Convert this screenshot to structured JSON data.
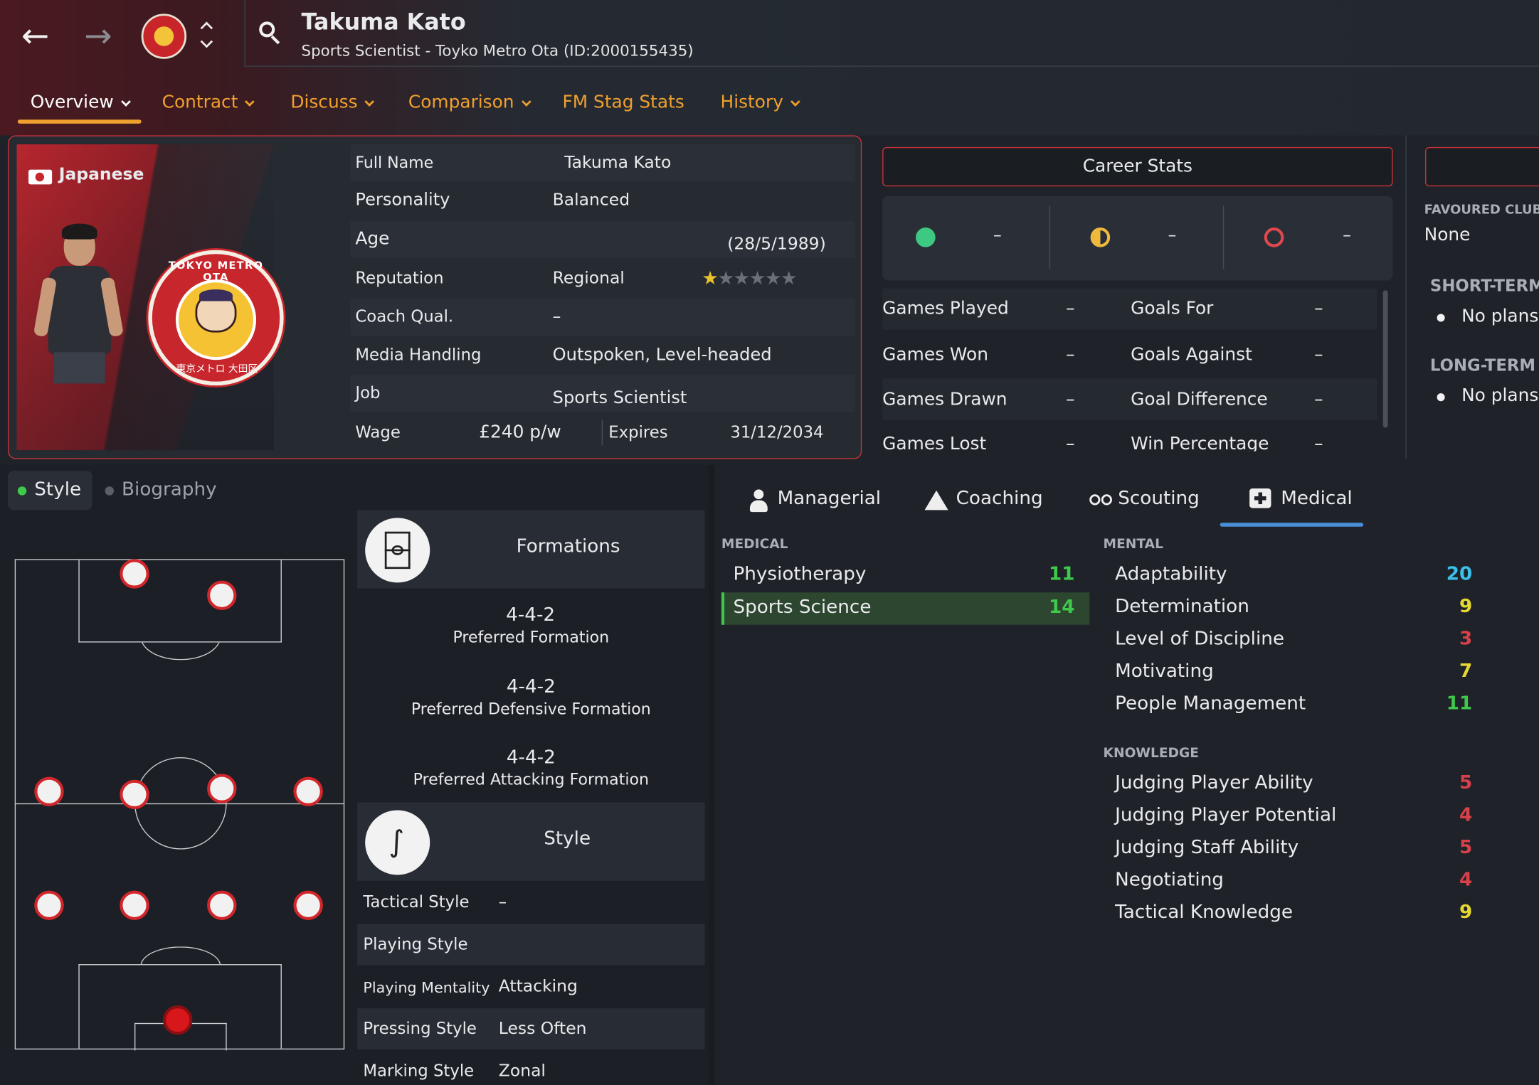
{
  "header": {
    "name": "Takuma Kato",
    "subtitle": "Sports Scientist - Toyko Metro Ota (ID:2000155435)"
  },
  "tabs": [
    {
      "label": "Overview"
    },
    {
      "label": "Contract"
    },
    {
      "label": "Discuss"
    },
    {
      "label": "Comparison"
    },
    {
      "label": "FM Stag Stats"
    },
    {
      "label": "History"
    }
  ],
  "profile": {
    "nationality": "Japanese",
    "club_badge_text": "TOKYO METRO OTA",
    "club_badge_sub": "東京メトロ 大田区",
    "rows": {
      "full_name_label": "Full Name",
      "full_name": "Takuma Kato",
      "personality_label": "Personality",
      "personality": "Balanced",
      "age_label": "Age",
      "age": "(28/5/1989)",
      "reputation_label": "Reputation",
      "reputation": "Regional",
      "reputation_stars": 0.5,
      "coach_label": "Coach Qual.",
      "coach": "–",
      "media_label": "Media Handling",
      "media": "Outspoken, Level-headed",
      "job_label": "Job",
      "job": "Sports Scientist",
      "wage_label": "Wage",
      "wage": "£240 p/w",
      "expires_label": "Expires",
      "expires": "31/12/2034"
    }
  },
  "career": {
    "title": "Career Stats",
    "results": [
      "–",
      "–",
      "–"
    ],
    "left_labels": [
      "Games Played",
      "Games Won",
      "Games Drawn",
      "Games Lost"
    ],
    "left_values": [
      "–",
      "–",
      "–",
      "–"
    ],
    "right_labels": [
      "Goals For",
      "Goals Against",
      "Goal Difference",
      "Win Percentage"
    ],
    "right_values": [
      "–",
      "–",
      "–",
      "–"
    ]
  },
  "right_panel": {
    "favoured_label": "FAVOURED CLUB",
    "favoured": "None",
    "short_label": "SHORT-TERM",
    "short_item": "No plans",
    "long_label": "LONG-TERM",
    "long_item": "No plans"
  },
  "style_tabs": {
    "style": "Style",
    "biography": "Biography"
  },
  "formations": {
    "header": "Formations",
    "items": [
      {
        "value": "4-4-2",
        "label": "Preferred Formation"
      },
      {
        "value": "4-4-2",
        "label": "Preferred Defensive Formation"
      },
      {
        "value": "4-4-2",
        "label": "Preferred Attacking Formation"
      }
    ]
  },
  "style": {
    "header": "Style",
    "rows": [
      {
        "label": "Tactical Style",
        "value": "–"
      },
      {
        "label": "Playing Style",
        "value": ""
      },
      {
        "label": "Playing Mentality",
        "value": "Attacking"
      },
      {
        "label": "Pressing Style",
        "value": "Less Often"
      },
      {
        "label": "Marking Style",
        "value": "Zonal"
      }
    ]
  },
  "attr_tabs": {
    "managerial": "Managerial",
    "coaching": "Coaching",
    "scouting": "Scouting",
    "medical": "Medical"
  },
  "attributes": {
    "medical_label": "MEDICAL",
    "medical": [
      {
        "name": "Physiotherapy",
        "value": "11"
      },
      {
        "name": "Sports Science",
        "value": "14"
      }
    ],
    "mental_label": "MENTAL",
    "mental": [
      {
        "name": "Adaptability",
        "value": "20"
      },
      {
        "name": "Determination",
        "value": "9"
      },
      {
        "name": "Level of Discipline",
        "value": "3"
      },
      {
        "name": "Motivating",
        "value": "7"
      },
      {
        "name": "People Management",
        "value": "11"
      }
    ],
    "knowledge_label": "KNOWLEDGE",
    "knowledge": [
      {
        "name": "Judging Player Ability",
        "value": "5"
      },
      {
        "name": "Judging Player Potential",
        "value": "4"
      },
      {
        "name": "Judging Staff Ability",
        "value": "5"
      },
      {
        "name": "Negotiating",
        "value": "4"
      },
      {
        "name": "Tactical Knowledge",
        "value": "9"
      }
    ]
  },
  "colors": {
    "accent": "#f0a02d",
    "frame_red": "#c8333a",
    "green": "#3ec94a",
    "yellow": "#e6d832",
    "red": "#d8404a",
    "cyan": "#3cc0e8",
    "tab_underline": "#4a8ed8"
  }
}
